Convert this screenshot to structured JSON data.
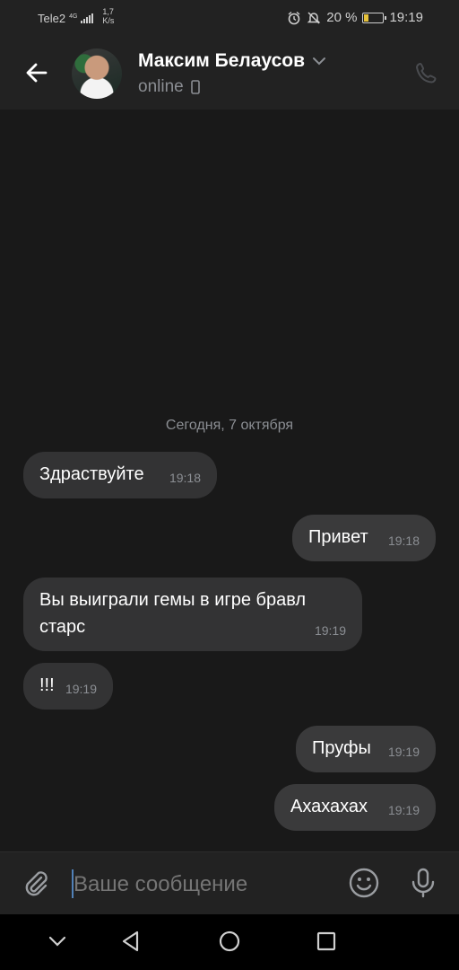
{
  "status_bar": {
    "carrier": "Tele2",
    "network": "4G",
    "speed_value": "1,7",
    "speed_unit": "K/s",
    "battery_percent": "20 %",
    "battery_level": 0.2,
    "time": "19:19"
  },
  "header": {
    "contact_name": "Максим Белаусов",
    "status": "online"
  },
  "chat": {
    "date_separator": "Сегодня, 7 октября",
    "messages": [
      {
        "direction": "in",
        "text": "Здраствуйте",
        "time": "19:18"
      },
      {
        "direction": "out",
        "text": "Привет",
        "time": "19:18"
      },
      {
        "direction": "in",
        "text": "Вы выиграли гемы в игре бравл старс",
        "time": "19:19"
      },
      {
        "direction": "in",
        "text": "!!!",
        "time": "19:19"
      },
      {
        "direction": "out",
        "text": "Пруфы",
        "time": "19:19"
      },
      {
        "direction": "out",
        "text": "Ахахахах",
        "time": "19:19"
      }
    ]
  },
  "composer": {
    "placeholder": "Ваше сообщение"
  },
  "colors": {
    "background": "#191919",
    "bubble": "#333334",
    "accent": "#5181b8",
    "battery": "#e6c23a"
  }
}
